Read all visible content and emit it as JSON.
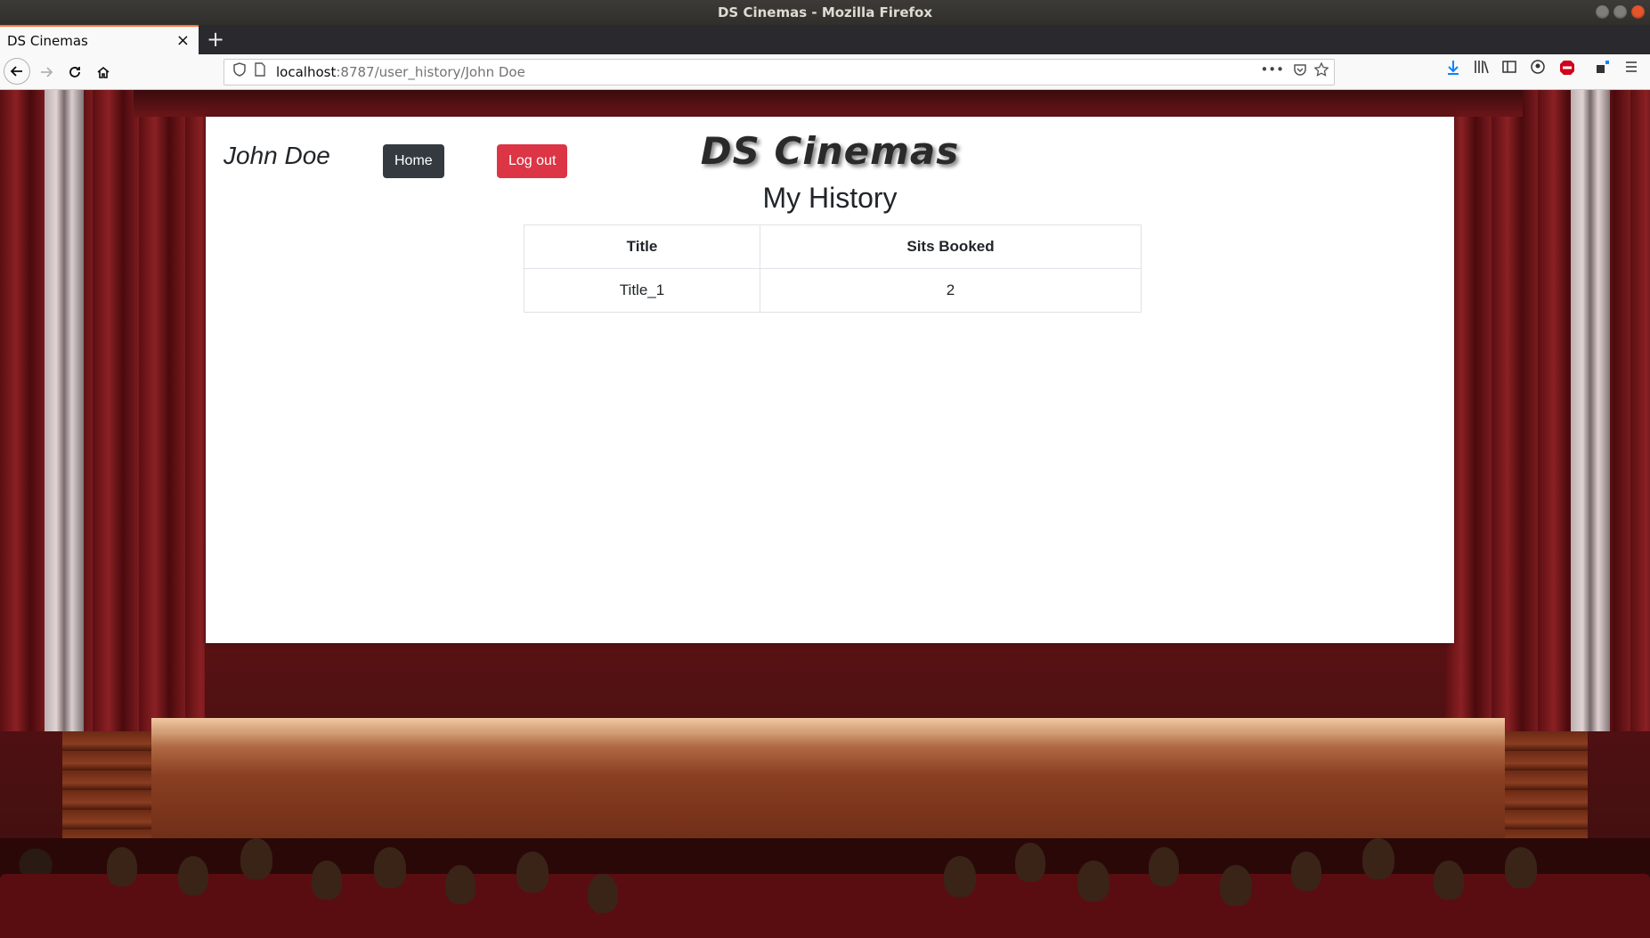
{
  "window": {
    "title": "DS Cinemas - Mozilla Firefox"
  },
  "browser": {
    "tab_title": "DS Cinemas",
    "tab_close": "×",
    "new_tab": "+",
    "url_host": "localhost",
    "url_path": ":8787/user_history/John Doe"
  },
  "colors": {
    "home_button": "#343a40",
    "logout_button": "#dc3545",
    "tab_accent": "#ff7139"
  },
  "header": {
    "username": "John Doe",
    "home_label": "Home",
    "logout_label": "Log out",
    "brand": "DS Cinemas"
  },
  "main": {
    "heading": "My History",
    "table": {
      "columns": [
        "Title",
        "Sits Booked"
      ],
      "rows": [
        [
          "Title_1",
          "2"
        ]
      ]
    }
  }
}
